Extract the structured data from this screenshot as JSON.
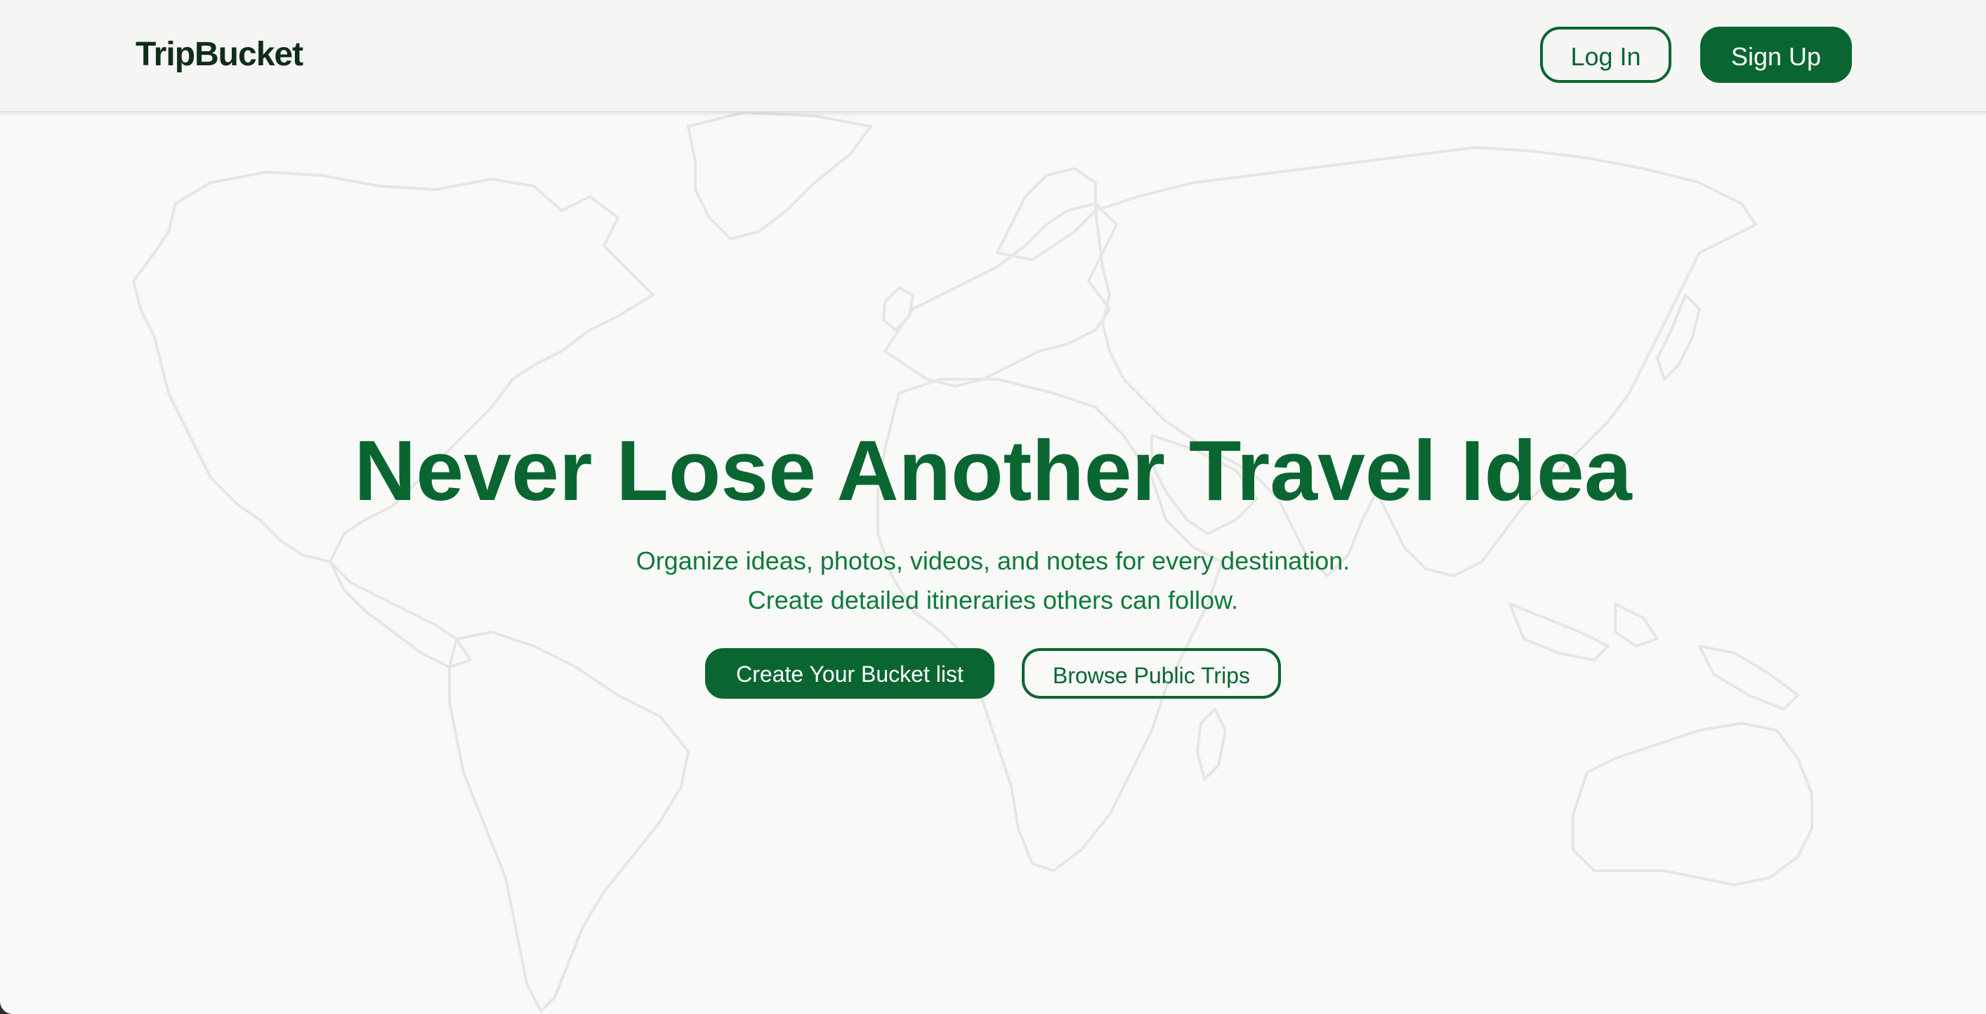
{
  "header": {
    "logo": "TripBucket",
    "login_label": "Log In",
    "signup_label": "Sign Up"
  },
  "hero": {
    "title": "Never Lose Another Travel Idea",
    "subtitle_line1": "Organize ideas, photos, videos, and notes for every destination.",
    "subtitle_line2": "Create detailed itineraries others can follow.",
    "primary_cta": "Create Your Bucket list",
    "secondary_cta": "Browse Public Trips"
  },
  "colors": {
    "brand_green": "#0a6631",
    "text_green": "#0e7a3a",
    "logo_dark": "#0f2d18",
    "background": "#f9f9f8",
    "map_outline": "#e6e6e4"
  },
  "background_graphic": "world-map-outline"
}
